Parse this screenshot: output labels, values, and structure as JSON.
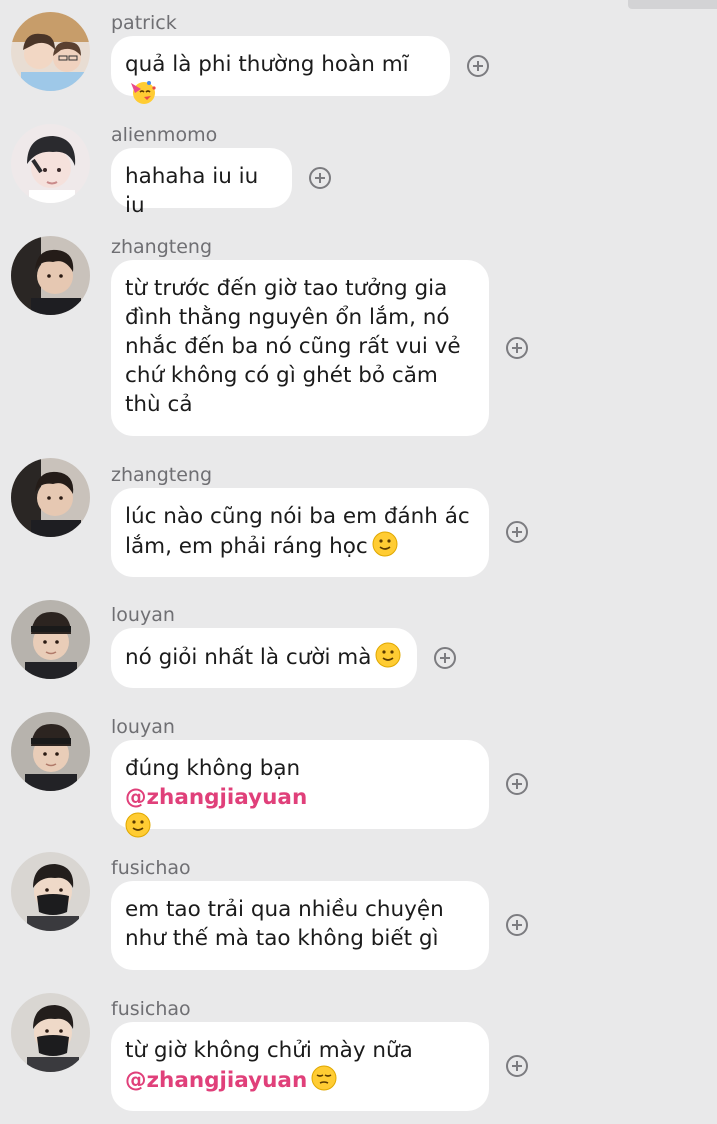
{
  "messages": [
    {
      "user": "patrick",
      "text": "quả là phi thường hoàn mĩ",
      "emoji": "party-face",
      "avatar": "two-boys-photo"
    },
    {
      "user": "alienmomo",
      "text": "hahaha iu iu iu",
      "avatar": "pale-boy-photo"
    },
    {
      "user": "zhangteng",
      "text": "từ trước đến giờ tao tưởng gia đình thằng nguyên ổn lắm, nó nhắc đến ba nó cũng rất vui vẻ chứ không có gì ghét bỏ căm thù cả",
      "avatar": "boy-portrait-photo"
    },
    {
      "user": "zhangteng",
      "text": "lúc nào cũng nói ba em đánh ác lắm, em phải ráng học",
      "emoji": "slight-smile",
      "avatar": "boy-portrait-photo"
    },
    {
      "user": "louyan",
      "text": "nó giỏi nhất là cười mà",
      "emoji": "slight-smile",
      "avatar": "headband-boy-photo"
    },
    {
      "user": "louyan",
      "text": "đúng không bạn",
      "mention": "@zhangjiayuan",
      "emoji": "slight-smile",
      "avatar": "headband-boy-photo"
    },
    {
      "user": "fusichao",
      "text": "em tao trải qua nhiều chuyện như thế mà tao không biết gì",
      "avatar": "masked-boy-photo"
    },
    {
      "user": "fusichao",
      "text": "từ giờ không chửi mày nữa",
      "mention": "@zhangjiayuan",
      "emoji": "pensive-face",
      "avatar": "masked-boy-photo"
    }
  ],
  "colors": {
    "background": "#e9e9ea",
    "bubble": "#ffffff",
    "mention": "#e0407a",
    "username": "#6f6f73"
  }
}
